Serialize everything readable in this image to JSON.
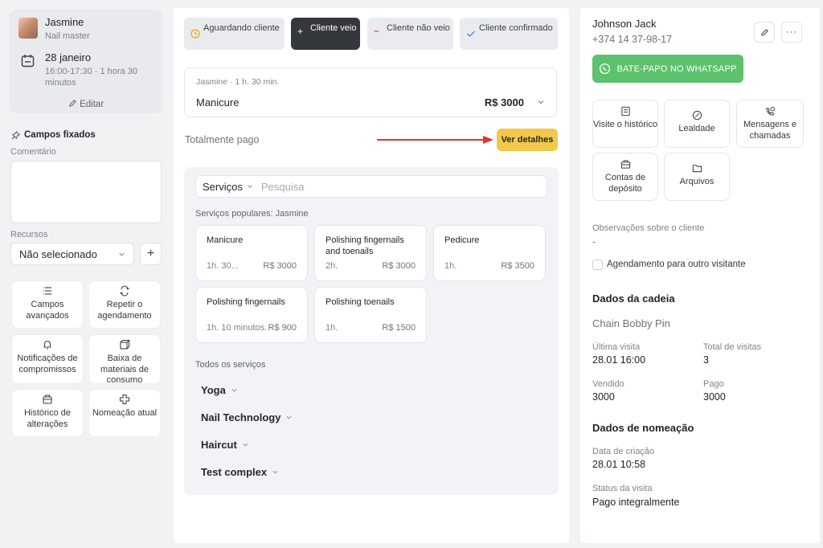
{
  "master": {
    "name": "Jasmine",
    "role": "Nail master",
    "date": "28 janeiro",
    "time": "16:00-17:30 · 1 hora 30 minutos",
    "edit_label": "Editar"
  },
  "left": {
    "pinned_label": "Campos fixados",
    "comment_label": "Comentário",
    "resources_label": "Recursos",
    "resources_value": "Não selecionado",
    "actions": [
      {
        "label": "Campos avançados",
        "icon": "list-icon"
      },
      {
        "label": "Repetir o agendamento",
        "icon": "repeat-icon"
      },
      {
        "label": "Notificações de compromissos",
        "icon": "bell-icon"
      },
      {
        "label": "Baixa de materiais de consumo",
        "icon": "boxes-icon"
      },
      {
        "label": "Histórico de alterações",
        "icon": "history-icon"
      },
      {
        "label": "Nomeação atual",
        "icon": "plus-cross-icon"
      }
    ]
  },
  "statuses": [
    {
      "label": "Aguardando cliente",
      "icon": "clock-icon",
      "color": "#f0a500"
    },
    {
      "label": "Cliente veio",
      "icon": "plus-icon",
      "color": "#ffffff"
    },
    {
      "label": "Cliente não veio",
      "icon": "minus-icon",
      "color": "#e5484d"
    },
    {
      "label": "Cliente confirmado",
      "icon": "check-icon",
      "color": "#4a7cf0"
    }
  ],
  "service": {
    "subtitle": "Jasmine · 1 h. 30 min.",
    "name": "Manicure",
    "price": "R$ 3000"
  },
  "payment": {
    "status": "Totalmente pago",
    "details_button": "Ver detalhes"
  },
  "services_panel": {
    "category": "Serviços",
    "search_placeholder": "Pesquisa",
    "popular_label": "Serviços populares: Jasmine",
    "popular": [
      {
        "name": "Manicure",
        "duration": "1h. 30...",
        "price": "R$ 3000"
      },
      {
        "name": "Polishing fingernails and toenails",
        "duration": "2h.",
        "price": "R$ 3000"
      },
      {
        "name": "Pedicure",
        "duration": "1h.",
        "price": "R$ 3500"
      },
      {
        "name": "Polishing fingernails",
        "duration": "1h. 10 minutos.",
        "price": "R$ 900"
      },
      {
        "name": "Polishing toenails",
        "duration": "1h.",
        "price": "R$ 1500"
      }
    ],
    "all_label": "Todos os serviços",
    "categories": [
      "Yoga",
      "Nail Technology",
      "Haircut",
      "Test complex"
    ]
  },
  "client": {
    "name": "Johnson Jack",
    "phone": "+374 14 37-98-17",
    "whatsapp_label": "BATE-PAPO NO WHATSAPP",
    "whatsapp_color": "#5dc16d",
    "tiles": [
      {
        "label": "Visite o histórico",
        "icon": "history-doc-icon"
      },
      {
        "label": "Lealdade",
        "icon": "loyalty-icon"
      },
      {
        "label": "Mensagens e chamadas",
        "icon": "phone-chat-icon"
      },
      {
        "label": "Contas de depósito",
        "icon": "wallet-icon"
      },
      {
        "label": "Arquivos",
        "icon": "folder-icon"
      }
    ],
    "notes_label": "Observações sobre o cliente",
    "notes_value": "-",
    "other_visitor_label": "Agendamento para outro visitante"
  },
  "chain": {
    "title": "Dados da cadeia",
    "name": "Chain Bobby Pin",
    "last_visit_label": "Última visita",
    "last_visit": "28.01 16:00",
    "total_visits_label": "Total de visitas",
    "total_visits": "3",
    "sold_label": "Vendido",
    "sold": "3000",
    "paid_label": "Pago",
    "paid": "3000"
  },
  "appointment": {
    "title": "Dados de nomeação",
    "created_label": "Data de criação",
    "created": "28.01 10:58",
    "visit_status_label": "Status da visita",
    "visit_status": "Pago integralmente"
  }
}
